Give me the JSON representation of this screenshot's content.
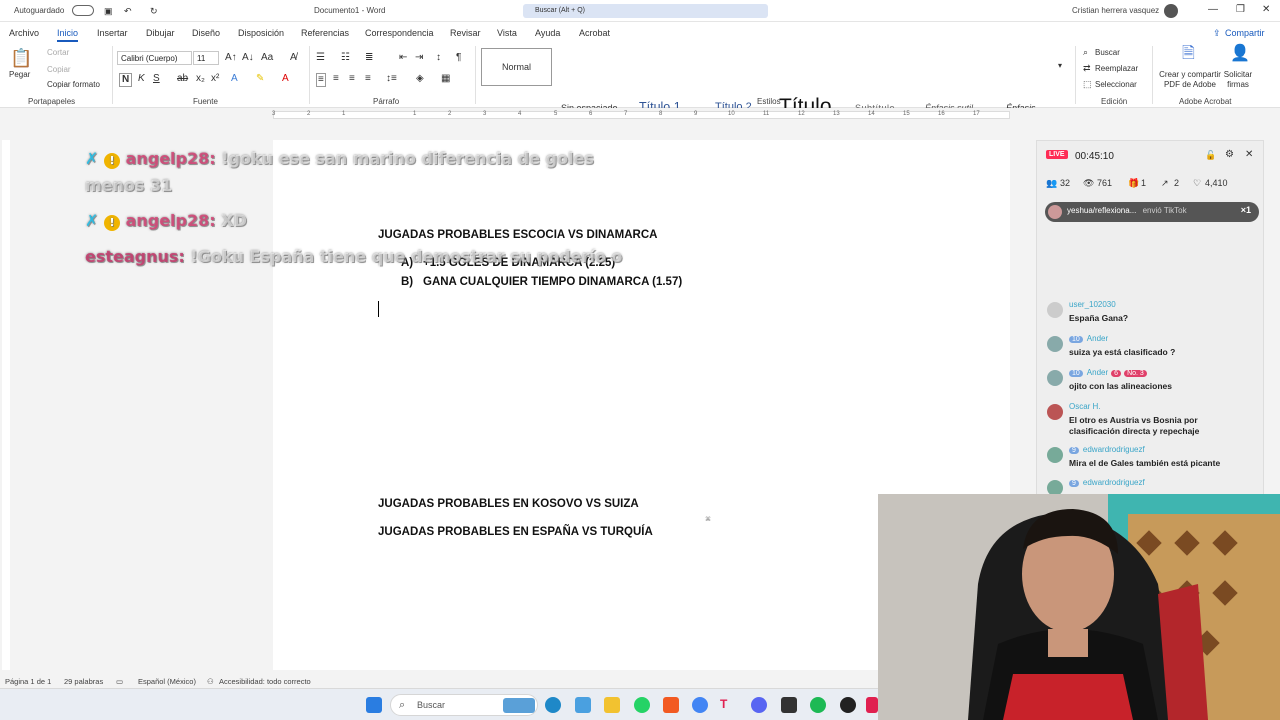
{
  "titlebar": {
    "autosave": "Autoguardado",
    "doc_title": "Documento1 - Word",
    "search_placeholder": "Buscar (Alt + Q)",
    "user": "Cristian herrera vasquez"
  },
  "tabs": [
    "Archivo",
    "Inicio",
    "Insertar",
    "Dibujar",
    "Diseño",
    "Disposición",
    "Referencias",
    "Correspondencia",
    "Revisar",
    "Vista",
    "Ayuda",
    "Acrobat"
  ],
  "share_label": "Compartir",
  "ribbon": {
    "clipboard": {
      "paste": "Pegar",
      "cut": "Cortar",
      "copy": "Copiar",
      "format_painter": "Copiar formato",
      "label": "Portapapeles"
    },
    "font": {
      "name": "Calibri (Cuerpo)",
      "size": "11",
      "label": "Fuente"
    },
    "paragraph": {
      "label": "Párrafo"
    },
    "styles": {
      "items": [
        "Normal",
        "Sin espaciado",
        "Título 1",
        "Título 2",
        "Título",
        "Subtítulo",
        "Énfasis sutil",
        "Énfasis"
      ],
      "label": "Estilos"
    },
    "editing": {
      "find": "Buscar",
      "replace": "Reemplazar",
      "select": "Seleccionar",
      "label": "Edición"
    },
    "acrobat": {
      "create": "Crear y compartir PDF de Adobe",
      "sign": "Solicitar firmas",
      "label": "Adobe Acrobat"
    }
  },
  "ruler_numbers": [
    "3",
    "2",
    "1",
    "1",
    "2",
    "3",
    "4",
    "5",
    "6",
    "7",
    "8",
    "9",
    "10",
    "11",
    "12",
    "13",
    "14",
    "15",
    "16",
    "17"
  ],
  "document": {
    "heading1": "JUGADAS PROBABLES ESCOCIA VS DINAMARCA",
    "item_a_marker": "A)",
    "item_a": "+1.5 GOLES DE DINAMARCA (2.25)",
    "item_b_marker": "B)",
    "item_b": "GANA CUALQUIER TIEMPO DINAMARCA (1.57)",
    "heading2": "JUGADAS PROBABLES EN KOSOVO VS SUIZA",
    "heading3": "JUGADAS PROBABLES EN ESPAÑA VS TURQUÍA"
  },
  "overlay_chat": [
    {
      "user": "angelp28:",
      "text": "!goku ese san marino diferencia de goles",
      "text2": "menos 31"
    },
    {
      "user": "angelp28:",
      "text": "XD"
    },
    {
      "user": "esteagnus:",
      "text": "!Goku España tiene que demostrar su poderío o"
    }
  ],
  "tiktok": {
    "live": "LIVE",
    "timer": "00:45:10",
    "stats": {
      "viewers": "32",
      "views": "761",
      "gifts": "1",
      "shares": "2",
      "likes": "4,410"
    },
    "gift_banner": {
      "user": "yeshua/reflexiona...",
      "text": "envió TikTok",
      "count": "×1"
    },
    "messages": [
      {
        "user": "user_102030",
        "text": "España Gana?"
      },
      {
        "level": "10",
        "user": "Ander",
        "text": "suiza ya está clasificado ?"
      },
      {
        "level": "10",
        "user": "Ander",
        "rank": "No. 3",
        "rank_level": "6",
        "text": "ojito con las alineaciones"
      },
      {
        "user": "Oscar H.",
        "text": "El otro es Austria vs Bosnia por clasificación directa y repechaje"
      },
      {
        "level": "9",
        "user": "edwardrodriguezf",
        "text": "Mira el de Gales también está picante"
      },
      {
        "level": "9",
        "user": "edwardrodriguezf",
        "text": ""
      }
    ]
  },
  "statusbar": {
    "page": "Página 1 de 1",
    "words": "29 palabras",
    "language": "Español (México)",
    "accessibility": "Accesibilidad: todo correcto"
  },
  "taskbar": {
    "search": "Buscar"
  }
}
